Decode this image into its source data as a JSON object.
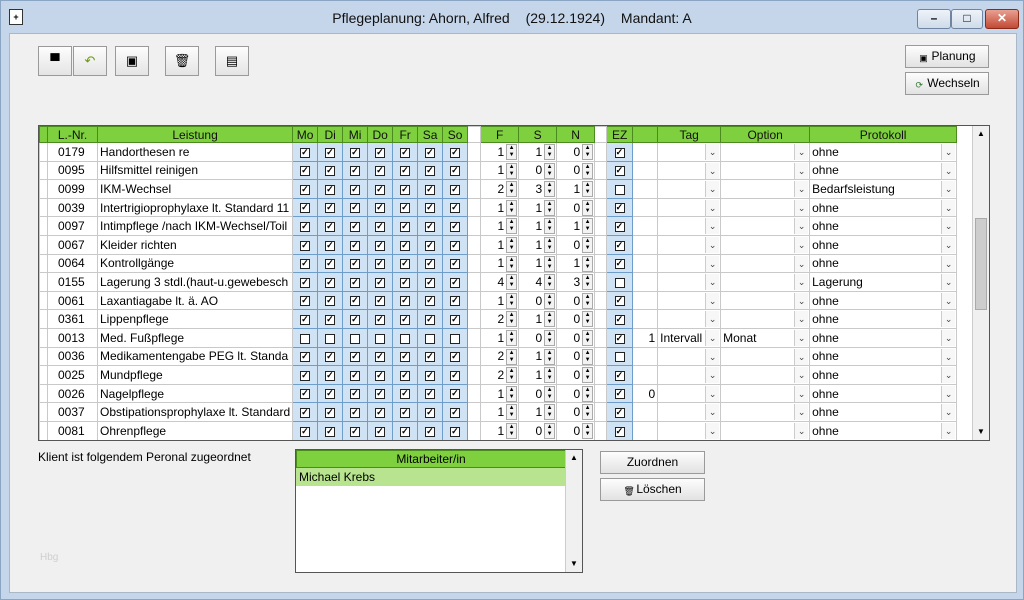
{
  "window": {
    "title_main": "Pflegeplanung: Ahorn, Alfred",
    "title_date": "(29.12.1924)",
    "title_mandant": "Mandant: A"
  },
  "toolbar": {
    "new_glyph": "▀",
    "undo_glyph": "↶",
    "save_glyph": "▣",
    "delete_glyph": "🗑",
    "print_glyph": "▤"
  },
  "right_buttons": {
    "planung": "Planung",
    "wechseln": "Wechseln"
  },
  "columns": [
    "L.-Nr.",
    "Leistung",
    "Mo",
    "Di",
    "Mi",
    "Do",
    "Fr",
    "Sa",
    "So",
    "F",
    "S",
    "N",
    "EZ",
    "",
    "Tag",
    "Option",
    "Protokoll"
  ],
  "rows": [
    {
      "nr": "0179",
      "leistung": "Handorthesen re",
      "days": [
        1,
        1,
        1,
        1,
        1,
        1,
        1
      ],
      "f": "1",
      "s": "1",
      "n": "0",
      "ez": 1,
      "tagnum": "",
      "tag": "",
      "option": "",
      "protokoll": "ohne"
    },
    {
      "nr": "0095",
      "leistung": "Hilfsmittel reinigen",
      "days": [
        1,
        1,
        1,
        1,
        1,
        1,
        1
      ],
      "f": "1",
      "s": "0",
      "n": "0",
      "ez": 1,
      "tagnum": "",
      "tag": "",
      "option": "",
      "protokoll": "ohne"
    },
    {
      "nr": "0099",
      "leistung": "IKM-Wechsel",
      "days": [
        1,
        1,
        1,
        1,
        1,
        1,
        1
      ],
      "f": "2",
      "s": "3",
      "n": "1",
      "ez": 0,
      "tagnum": "",
      "tag": "",
      "option": "",
      "protokoll": "Bedarfsleistung"
    },
    {
      "nr": "0039",
      "leistung": "Intertrigioprophylaxe lt. Standard 11",
      "days": [
        1,
        1,
        1,
        1,
        1,
        1,
        1
      ],
      "f": "1",
      "s": "1",
      "n": "0",
      "ez": 1,
      "tagnum": "",
      "tag": "",
      "option": "",
      "protokoll": "ohne"
    },
    {
      "nr": "0097",
      "leistung": "Intimpflege /nach IKM-Wechsel/Toil",
      "days": [
        1,
        1,
        1,
        1,
        1,
        1,
        1
      ],
      "f": "1",
      "s": "1",
      "n": "1",
      "ez": 1,
      "tagnum": "",
      "tag": "",
      "option": "",
      "protokoll": "ohne"
    },
    {
      "nr": "0067",
      "leistung": "Kleider richten",
      "days": [
        1,
        1,
        1,
        1,
        1,
        1,
        1
      ],
      "f": "1",
      "s": "1",
      "n": "0",
      "ez": 1,
      "tagnum": "",
      "tag": "",
      "option": "",
      "protokoll": "ohne"
    },
    {
      "nr": "0064",
      "leistung": "Kontrollgänge",
      "days": [
        1,
        1,
        1,
        1,
        1,
        1,
        1
      ],
      "f": "1",
      "s": "1",
      "n": "1",
      "ez": 1,
      "tagnum": "",
      "tag": "",
      "option": "",
      "protokoll": "ohne"
    },
    {
      "nr": "0155",
      "leistung": "Lagerung 3 stdl.(haut-u.gewebesch",
      "days": [
        1,
        1,
        1,
        1,
        1,
        1,
        1
      ],
      "f": "4",
      "s": "4",
      "n": "3",
      "ez": 0,
      "tagnum": "",
      "tag": "",
      "option": "",
      "protokoll": "Lagerung"
    },
    {
      "nr": "0061",
      "leistung": "Laxantiagabe lt. ä. AO",
      "days": [
        1,
        1,
        1,
        1,
        1,
        1,
        1
      ],
      "f": "1",
      "s": "0",
      "n": "0",
      "ez": 1,
      "tagnum": "",
      "tag": "",
      "option": "",
      "protokoll": "ohne"
    },
    {
      "nr": "0361",
      "leistung": "Lippenpflege",
      "days": [
        1,
        1,
        1,
        1,
        1,
        1,
        1
      ],
      "f": "2",
      "s": "1",
      "n": "0",
      "ez": 1,
      "tagnum": "",
      "tag": "",
      "option": "",
      "protokoll": "ohne"
    },
    {
      "nr": "0013",
      "leistung": "Med. Fußpflege",
      "days": [
        0,
        0,
        0,
        0,
        0,
        0,
        0
      ],
      "f": "1",
      "s": "0",
      "n": "0",
      "ez": 1,
      "tagnum": "1",
      "tag": "Intervall",
      "option": "Monat",
      "protokoll": "ohne"
    },
    {
      "nr": "0036",
      "leistung": "Medikamentengabe PEG lt. Standa",
      "days": [
        1,
        1,
        1,
        1,
        1,
        1,
        1
      ],
      "f": "2",
      "s": "1",
      "n": "0",
      "ez": 0,
      "tagnum": "",
      "tag": "",
      "option": "",
      "protokoll": "ohne"
    },
    {
      "nr": "0025",
      "leistung": "Mundpflege",
      "days": [
        1,
        1,
        1,
        1,
        1,
        1,
        1
      ],
      "f": "2",
      "s": "1",
      "n": "0",
      "ez": 1,
      "tagnum": "",
      "tag": "",
      "option": "",
      "protokoll": "ohne"
    },
    {
      "nr": "0026",
      "leistung": "Nagelpflege",
      "days": [
        1,
        1,
        1,
        1,
        1,
        1,
        1
      ],
      "f": "1",
      "s": "0",
      "n": "0",
      "ez": 1,
      "tagnum": "0",
      "tag": "",
      "option": "",
      "protokoll": "ohne"
    },
    {
      "nr": "0037",
      "leistung": "Obstipationsprophylaxe lt. Standard",
      "days": [
        1,
        1,
        1,
        1,
        1,
        1,
        1
      ],
      "f": "1",
      "s": "1",
      "n": "0",
      "ez": 1,
      "tagnum": "",
      "tag": "",
      "option": "",
      "protokoll": "ohne"
    },
    {
      "nr": "0081",
      "leistung": "Ohrenpflege",
      "days": [
        1,
        1,
        1,
        1,
        1,
        1,
        1
      ],
      "f": "1",
      "s": "0",
      "n": "0",
      "ez": 1,
      "tagnum": "",
      "tag": "",
      "option": "",
      "protokoll": "ohne"
    }
  ],
  "assignment": {
    "label": "Klient ist folgendem Peronal zugeordnet",
    "header": "Mitarbeiter/in",
    "staff": [
      "Michael Krebs"
    ],
    "assign_button": "Zuordnen",
    "delete_button": "Löschen"
  },
  "corner_tag": "Hbg",
  "colors": {
    "header_green": "#7fd03f",
    "selected_row": "#b9e48f",
    "day_cell": "#cfe3f5"
  }
}
